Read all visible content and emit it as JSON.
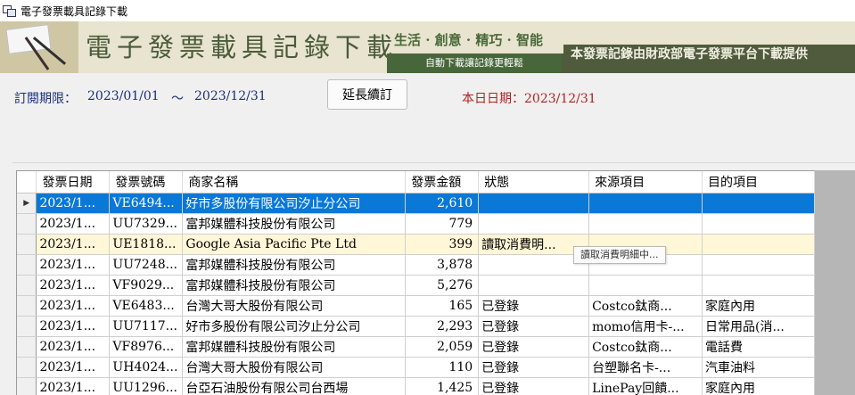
{
  "window": {
    "title": "電子發票載具記錄下載"
  },
  "banner": {
    "main_title": "電子發票載具記錄下載",
    "slogan": "生活 · 創意 · 精巧 · 智能",
    "sub_slogan": "自動下載讓記錄更輕鬆",
    "provider": "本發票記錄由財政部電子發票平台下載提供"
  },
  "subscription": {
    "label": "訂閱期限：",
    "from": "2023/01/01",
    "separator": "～",
    "to": "2023/12/31",
    "extend_button": "延長續訂",
    "today_label": "本日日期：2023/12/31"
  },
  "grid": {
    "columns": [
      "發票日期",
      "發票號碼",
      "商家名稱",
      "發票金額",
      "狀態",
      "來源項目",
      "目的項目"
    ],
    "selected_row_marker": "▶",
    "rows": [
      [
        "2023/1...",
        "VE6494...",
        "好市多股份有限公司汐止分公司",
        "2,610",
        "",
        "",
        ""
      ],
      [
        "2023/1...",
        "UU7329...",
        "富邦媒體科技股份有限公司",
        "779",
        "",
        "",
        ""
      ],
      [
        "2023/1...",
        "UE1818...",
        "Google Asia Pacific Pte Ltd",
        "399",
        "讀取消費明...",
        "",
        ""
      ],
      [
        "2023/1...",
        "UU7248...",
        "富邦媒體科技股份有限公司",
        "3,878",
        "",
        "",
        ""
      ],
      [
        "2023/1...",
        "VF9029...",
        "富邦媒體科技股份有限公司",
        "5,276",
        "",
        "",
        ""
      ],
      [
        "2023/1...",
        "VE6483...",
        "台灣大哥大股份有限公司",
        "165",
        "已登錄",
        "Costco鈦商...",
        "家庭內用"
      ],
      [
        "2023/1...",
        "UU7117...",
        "好市多股份有限公司汐止分公司",
        "2,293",
        "已登錄",
        "momo信用卡-...",
        "日常用品(消..."
      ],
      [
        "2023/1...",
        "VF8976...",
        "富邦媒體科技股份有限公司",
        "2,059",
        "已登錄",
        "Costco鈦商...",
        "電話費"
      ],
      [
        "2023/1...",
        "UH4024...",
        "台灣大哥大股份有限公司",
        "110",
        "已登錄",
        "台塑聯名卡-...",
        "汽車油料"
      ],
      [
        "2023/1...",
        "UU1296...",
        "台亞石油股份有限公司台西場",
        "1,425",
        "已登錄",
        "LinePay回饋...",
        "家庭內用"
      ]
    ],
    "tooltip": "讀取消費明細中..."
  },
  "colors": {
    "selection": "#0a78d7",
    "highlight_row": "#fff7d8",
    "period_text": "#1a2e7a",
    "today_text": "#b22222",
    "banner_green": "#4f5b3c"
  }
}
